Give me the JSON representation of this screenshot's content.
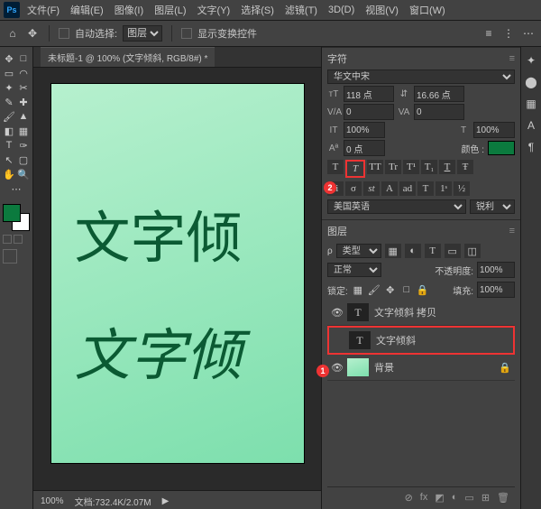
{
  "menu": {
    "items": [
      "文件(F)",
      "编辑(E)",
      "图像(I)",
      "图层(L)",
      "文字(Y)",
      "选择(S)",
      "滤镜(T)",
      "3D(D)",
      "视图(V)",
      "窗口(W)"
    ]
  },
  "toolbar": {
    "autoselect": "自动选择:",
    "layer": "图层",
    "showcontrols": "显示变换控件"
  },
  "doc": {
    "tab": "未标题-1 @ 100% (文字倾斜, RGB/8#) *",
    "zoom": "100%",
    "info": "文档:732.4K/2.07M"
  },
  "canvas": {
    "t1": "文字倾",
    "t2": "文字倾"
  },
  "char": {
    "title": "字符",
    "font": "华文中宋",
    "size": "118 点",
    "leading": "16.66 点",
    "tracking": "0",
    "va": "0",
    "vscale": "100%",
    "hscale": "100%",
    "baseline": "0 点",
    "colorlabel": "颜色 :",
    "lang": "美国英语",
    "aa": "锐利",
    "styles": [
      "T",
      "T",
      "TT",
      "Tr",
      "T¹",
      "T₁",
      "T",
      "Ŧ"
    ]
  },
  "layers": {
    "title": "图层",
    "kind": "类型",
    "blend": "正常",
    "opacitylab": "不透明度:",
    "opacity": "100%",
    "locklab": "锁定:",
    "filllab": "填充:",
    "fill": "100%",
    "items": [
      {
        "name": "文字倾斜 拷贝",
        "type": "T"
      },
      {
        "name": "文字倾斜",
        "type": "T"
      },
      {
        "name": "背景",
        "type": "bg"
      }
    ]
  },
  "markers": {
    "m1": "1",
    "m2": "2"
  }
}
